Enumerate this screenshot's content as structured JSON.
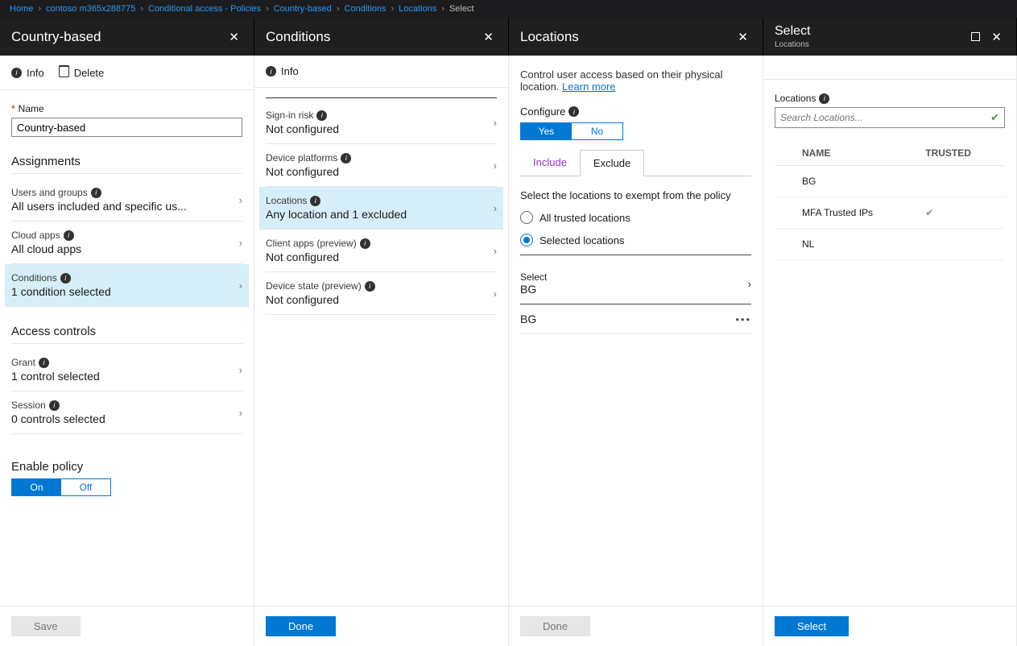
{
  "breadcrumb": [
    "Home",
    "contoso m365x288775",
    "Conditional access - Policies",
    "Country-based",
    "Conditions",
    "Locations",
    "Select"
  ],
  "blade1": {
    "title": "Country-based",
    "cmd_info": "Info",
    "cmd_delete": "Delete",
    "name_label": "Name",
    "name_value": "Country-based",
    "section_assign": "Assignments",
    "rows": [
      {
        "t": "Users and groups",
        "v": "All users included and specific us..."
      },
      {
        "t": "Cloud apps",
        "v": "All cloud apps"
      },
      {
        "t": "Conditions",
        "v": "1 condition selected",
        "sel": true
      }
    ],
    "section_access": "Access controls",
    "rows2": [
      {
        "t": "Grant",
        "v": "1 control selected"
      },
      {
        "t": "Session",
        "v": "0 controls selected"
      }
    ],
    "enable_label": "Enable policy",
    "toggle_on": "On",
    "toggle_off": "Off",
    "save": "Save"
  },
  "blade2": {
    "title": "Conditions",
    "cmd_info": "Info",
    "rows": [
      {
        "t": "Sign-in risk",
        "v": "Not configured"
      },
      {
        "t": "Device platforms",
        "v": "Not configured"
      },
      {
        "t": "Locations",
        "v": "Any location and 1 excluded",
        "sel": true
      },
      {
        "t": "Client apps (preview)",
        "v": "Not configured"
      },
      {
        "t": "Device state (preview)",
        "v": "Not configured"
      }
    ],
    "done": "Done"
  },
  "blade3": {
    "title": "Locations",
    "desc": "Control user access based on their physical location. ",
    "learn": "Learn more",
    "configure": "Configure",
    "yes": "Yes",
    "no": "No",
    "tab_in": "Include",
    "tab_ex": "Exclude",
    "instr": "Select the locations to exempt from the policy",
    "radio1": "All trusted locations",
    "radio2": "Selected locations",
    "sel_label": "Select",
    "sel_value": "BG",
    "picked": "BG",
    "done": "Done"
  },
  "blade4": {
    "title": "Select",
    "subtitle": "Locations",
    "loc_label": "Locations",
    "search_ph": "Search Locations...",
    "th_name": "NAME",
    "th_trusted": "TRUSTED",
    "rows": [
      {
        "name": "BG",
        "trusted": false
      },
      {
        "name": "MFA Trusted IPs",
        "trusted": true
      },
      {
        "name": "NL",
        "trusted": false
      }
    ],
    "select_btn": "Select"
  }
}
